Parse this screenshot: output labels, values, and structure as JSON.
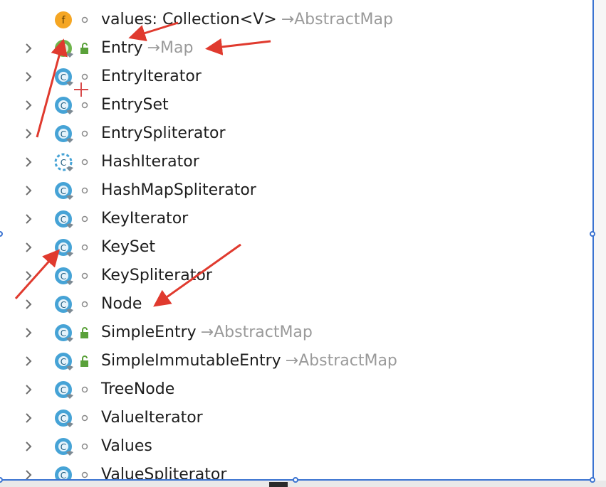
{
  "tree": {
    "field_row": {
      "icon": "field-icon",
      "icon_letter": "f",
      "name": "values: Collection<V>",
      "owner": "→AbstractMap"
    },
    "items": [
      {
        "name": "Entry",
        "owner": "→Map",
        "icon": "interface-icon",
        "icon_letter": "I",
        "visibility": "public"
      },
      {
        "name": "EntryIterator",
        "owner": "",
        "icon": "class-icon",
        "icon_letter": "C",
        "visibility": "package"
      },
      {
        "name": "EntrySet",
        "owner": "",
        "icon": "class-icon",
        "icon_letter": "C",
        "visibility": "package"
      },
      {
        "name": "EntrySpliterator",
        "owner": "",
        "icon": "class-icon",
        "icon_letter": "C",
        "visibility": "package"
      },
      {
        "name": "HashIterator",
        "owner": "",
        "icon": "abstract-class-icon",
        "icon_letter": "C",
        "visibility": "package"
      },
      {
        "name": "HashMapSpliterator",
        "owner": "",
        "icon": "class-icon",
        "icon_letter": "C",
        "visibility": "package"
      },
      {
        "name": "KeyIterator",
        "owner": "",
        "icon": "class-icon",
        "icon_letter": "C",
        "visibility": "package"
      },
      {
        "name": "KeySet",
        "owner": "",
        "icon": "class-icon",
        "icon_letter": "C",
        "visibility": "package"
      },
      {
        "name": "KeySpliterator",
        "owner": "",
        "icon": "class-icon",
        "icon_letter": "C",
        "visibility": "package"
      },
      {
        "name": "Node",
        "owner": "",
        "icon": "class-icon",
        "icon_letter": "C",
        "visibility": "package"
      },
      {
        "name": "SimpleEntry",
        "owner": "→AbstractMap",
        "icon": "class-icon",
        "icon_letter": "C",
        "visibility": "public"
      },
      {
        "name": "SimpleImmutableEntry",
        "owner": "→AbstractMap",
        "icon": "class-icon",
        "icon_letter": "C",
        "visibility": "public"
      },
      {
        "name": "TreeNode",
        "owner": "",
        "icon": "class-icon",
        "icon_letter": "C",
        "visibility": "package"
      },
      {
        "name": "ValueIterator",
        "owner": "",
        "icon": "class-icon",
        "icon_letter": "C",
        "visibility": "package"
      },
      {
        "name": "Values",
        "owner": "",
        "icon": "class-icon",
        "icon_letter": "C",
        "visibility": "package"
      },
      {
        "name": "ValueSpliterator",
        "owner": "",
        "icon": "class-icon",
        "icon_letter": "C",
        "visibility": "package"
      }
    ]
  },
  "colors": {
    "class_icon": "#46a3d6",
    "class_icon_inner": "#e6f3fb",
    "interface_icon": "#6fb44c",
    "field_icon": "#f5a623",
    "lock": "#5aa13a",
    "annotation_arrow": "#e03a2e",
    "frame": "#3a73d1",
    "label": "#1d1d1d",
    "owner": "#9a9a9a"
  }
}
